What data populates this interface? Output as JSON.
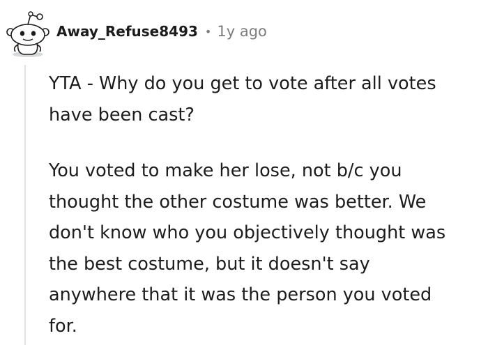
{
  "comment": {
    "avatar": {
      "icon": "snoo-avatar-icon",
      "colors": {
        "background": "#ffffff",
        "outline": "#1c1c1c",
        "shadow": "#d7dadc"
      }
    },
    "author": "Away_Refuse8493",
    "separator": "•",
    "age": "1y ago",
    "paragraphs": [
      {
        "lines": [
          "YTA - Why do you get to vote after all votes",
          "have been cast?"
        ]
      },
      {
        "lines": [
          "You voted to make her lose, not b/c you",
          "thought the other costume was better. We",
          "don't know who you objectively thought was",
          "the best costume, but it doesn't say",
          "anywhere that it was the person you voted",
          "for."
        ]
      }
    ],
    "colors": {
      "text": "#1c1c1c",
      "meta": "#7c7c7c",
      "thread_line": "#e3e3e3"
    }
  }
}
